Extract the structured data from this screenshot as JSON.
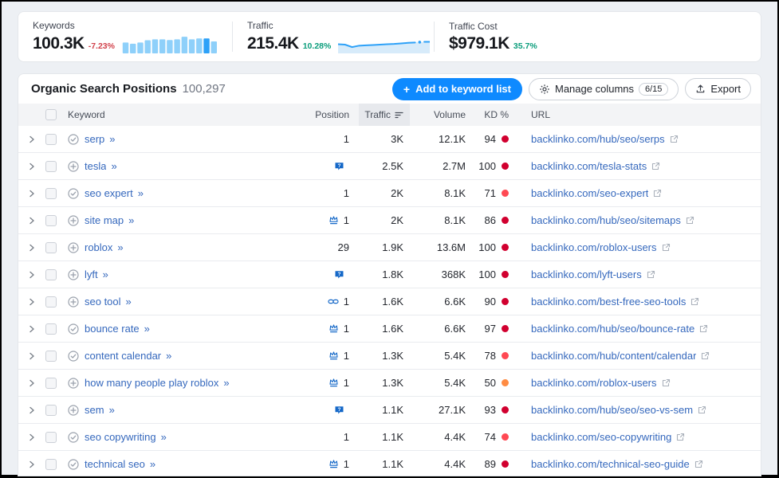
{
  "stats": {
    "keywords": {
      "label": "Keywords",
      "value": "100.3K",
      "change": "-7.23%",
      "trend": "down"
    },
    "traffic": {
      "label": "Traffic",
      "value": "215.4K",
      "change": "10.28%",
      "trend": "up"
    },
    "traffic_cost": {
      "label": "Traffic Cost",
      "value": "$979.1K",
      "change": "35.7%",
      "trend": "up"
    }
  },
  "chart_data": [
    {
      "type": "bar",
      "title": "Keywords sparkline",
      "values": [
        62,
        55,
        62,
        75,
        80,
        80,
        76,
        80,
        95,
        80,
        85,
        85,
        68
      ],
      "highlight_index": 11,
      "bar_color": "#8ed0fa",
      "highlight_color": "#2da1f8"
    },
    {
      "type": "line",
      "title": "Traffic sparkline",
      "values": [
        52,
        50,
        36,
        44,
        46,
        48,
        50,
        52,
        54,
        57,
        60,
        62
      ],
      "dot_value": 64,
      "dash_value": 66,
      "line_color": "#2da1f8",
      "area_color": "#d7ebfa"
    }
  ],
  "toolbar": {
    "title": "Organic Search Positions",
    "count": "100,297",
    "add_plus": "+",
    "add_button": "Add to keyword list",
    "manage_columns": "Manage columns",
    "columns_badge": "6/15",
    "export": "Export"
  },
  "table": {
    "more_glyph": "»",
    "columns": {
      "keyword": "Keyword",
      "position": "Position",
      "traffic": "Traffic",
      "volume": "Volume",
      "kd": "KD %",
      "url": "URL"
    },
    "rows": [
      {
        "keyword": "serp",
        "list_icon": "check",
        "feature": "none",
        "position": "1",
        "traffic": "3K",
        "volume": "12.1K",
        "kd": "94",
        "kd_color": "#d1002f",
        "url": "backlinko.com/hub/seo/serps"
      },
      {
        "keyword": "tesla",
        "list_icon": "plus",
        "feature": "chat",
        "position": "",
        "traffic": "2.5K",
        "volume": "2.7M",
        "kd": "100",
        "kd_color": "#d1002f",
        "url": "backlinko.com/tesla-stats"
      },
      {
        "keyword": "seo expert",
        "list_icon": "check",
        "feature": "none",
        "position": "1",
        "traffic": "2K",
        "volume": "8.1K",
        "kd": "71",
        "kd_color": "#ff4953",
        "url": "backlinko.com/seo-expert"
      },
      {
        "keyword": "site map",
        "list_icon": "plus",
        "feature": "crown",
        "position": "1",
        "traffic": "2K",
        "volume": "8.1K",
        "kd": "86",
        "kd_color": "#d1002f",
        "url": "backlinko.com/hub/seo/sitemaps"
      },
      {
        "keyword": "roblox",
        "list_icon": "plus",
        "feature": "none",
        "position": "29",
        "traffic": "1.9K",
        "volume": "13.6M",
        "kd": "100",
        "kd_color": "#d1002f",
        "url": "backlinko.com/roblox-users"
      },
      {
        "keyword": "lyft",
        "list_icon": "plus",
        "feature": "chat",
        "position": "",
        "traffic": "1.8K",
        "volume": "368K",
        "kd": "100",
        "kd_color": "#d1002f",
        "url": "backlinko.com/lyft-users"
      },
      {
        "keyword": "seo tool",
        "list_icon": "plus",
        "feature": "link",
        "position": "1",
        "traffic": "1.6K",
        "volume": "6.6K",
        "kd": "90",
        "kd_color": "#d1002f",
        "url": "backlinko.com/best-free-seo-tools"
      },
      {
        "keyword": "bounce rate",
        "list_icon": "check",
        "feature": "crown",
        "position": "1",
        "traffic": "1.6K",
        "volume": "6.6K",
        "kd": "97",
        "kd_color": "#d1002f",
        "url": "backlinko.com/hub/seo/bounce-rate"
      },
      {
        "keyword": "content calendar",
        "list_icon": "check",
        "feature": "crown",
        "position": "1",
        "traffic": "1.3K",
        "volume": "5.4K",
        "kd": "78",
        "kd_color": "#ff4953",
        "url": "backlinko.com/hub/content/calendar"
      },
      {
        "keyword": "how many people play roblox",
        "list_icon": "plus",
        "feature": "crown",
        "position": "1",
        "traffic": "1.3K",
        "volume": "5.4K",
        "kd": "50",
        "kd_color": "#ff8c43",
        "url": "backlinko.com/roblox-users"
      },
      {
        "keyword": "sem",
        "list_icon": "plus",
        "feature": "chat",
        "position": "",
        "traffic": "1.1K",
        "volume": "27.1K",
        "kd": "93",
        "kd_color": "#d1002f",
        "url": "backlinko.com/hub/seo/seo-vs-sem"
      },
      {
        "keyword": "seo copywriting",
        "list_icon": "check",
        "feature": "none",
        "position": "1",
        "traffic": "1.1K",
        "volume": "4.4K",
        "kd": "74",
        "kd_color": "#ff4953",
        "url": "backlinko.com/seo-copywriting"
      },
      {
        "keyword": "technical seo",
        "list_icon": "check",
        "feature": "crown",
        "position": "1",
        "traffic": "1.1K",
        "volume": "4.4K",
        "kd": "89",
        "kd_color": "#d1002f",
        "url": "backlinko.com/technical-seo-guide"
      }
    ]
  }
}
